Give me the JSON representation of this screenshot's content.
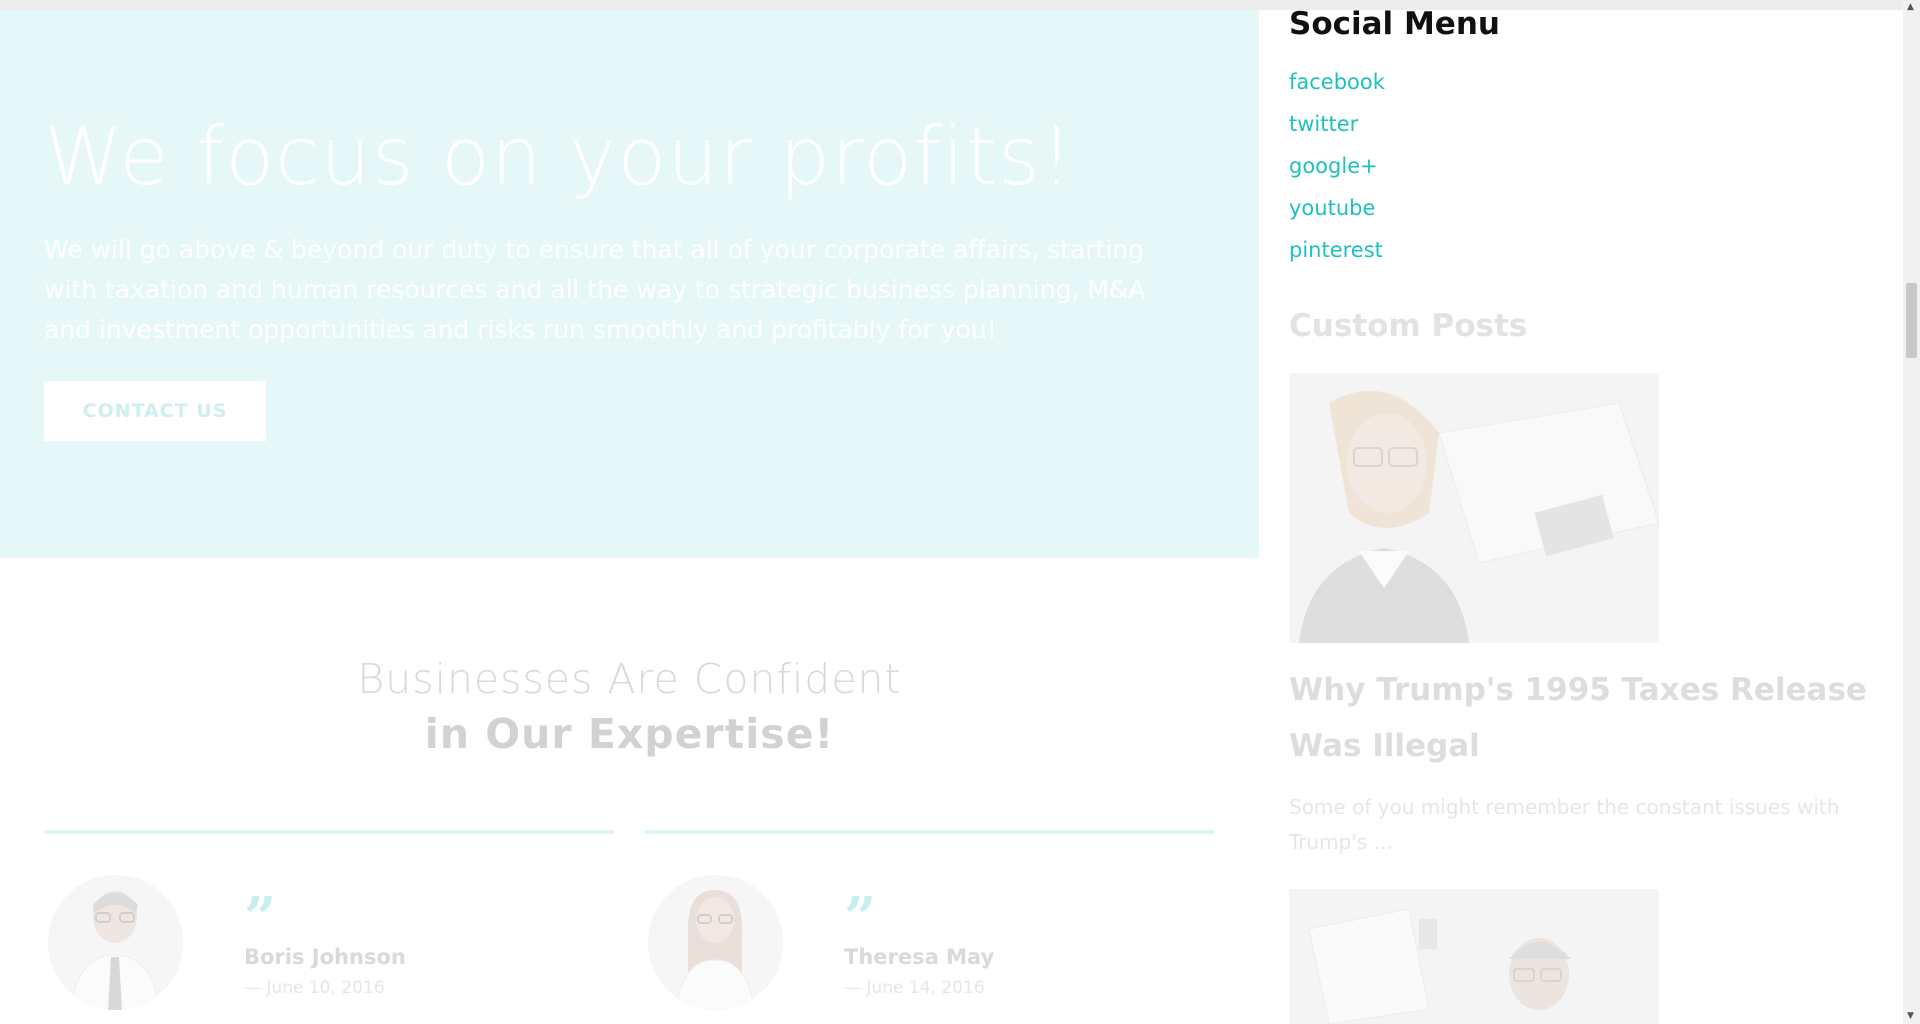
{
  "hero": {
    "title": "We focus on your profits!",
    "text": "We will go above & beyond our duty to ensure that all of your corporate affairs, starting with taxation and human resources and all the way to strategic business planning, M&A and investment opportunities and risks run smoothly and profitably for you!",
    "button_label": "CONTACT US"
  },
  "testimonials": {
    "title_line1": "Businesses Are Confident",
    "title_line2": "in Our Expertise!",
    "quote_mark": "”",
    "items": [
      {
        "name": "Boris Johnson",
        "date": "— June 10, 2016"
      },
      {
        "name": "Theresa May",
        "date": "— June 14, 2016"
      }
    ]
  },
  "sidebar": {
    "social_heading": "Social Menu",
    "social_links": [
      "facebook",
      "twitter",
      "google+",
      "youtube",
      "pinterest"
    ],
    "custom_heading": "Custom Posts",
    "post": {
      "title": "Why Trump's 1995 Taxes Release Was Illegal",
      "excerpt": "Some of you might remember the constant issues with Trump's ..."
    }
  },
  "colors": {
    "accent": "#1ec0c0",
    "hero_bg": "#e5f7f7",
    "muted_text": "#d9d9d9"
  }
}
